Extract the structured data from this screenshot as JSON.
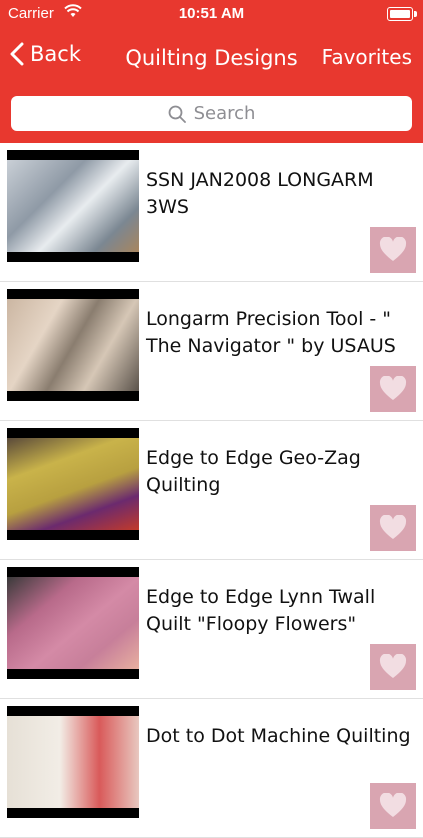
{
  "status_bar": {
    "carrier": "Carrier",
    "time": "10:51 AM"
  },
  "nav": {
    "back_label": "Back",
    "title": "Quilting Designs",
    "favorites_label": "Favorites"
  },
  "search": {
    "placeholder": "Search"
  },
  "videos": [
    {
      "title": "SSN JAN2008 LONGARM 3WS"
    },
    {
      "title": "Longarm Precision Tool - \" The Navigator \" by USAUS"
    },
    {
      "title": "Edge to Edge Geo-Zag Quilting"
    },
    {
      "title": "Edge to Edge Lynn Twall Quilt \"Floopy Flowers\""
    },
    {
      "title": "Dot to Dot Machine Quilting"
    }
  ],
  "colors": {
    "header": "#e8382f",
    "favorite_button": "#d9a5b1"
  },
  "icons": {
    "back": "chevron-left-icon",
    "search": "search-icon",
    "favorite": "heart-icon"
  }
}
